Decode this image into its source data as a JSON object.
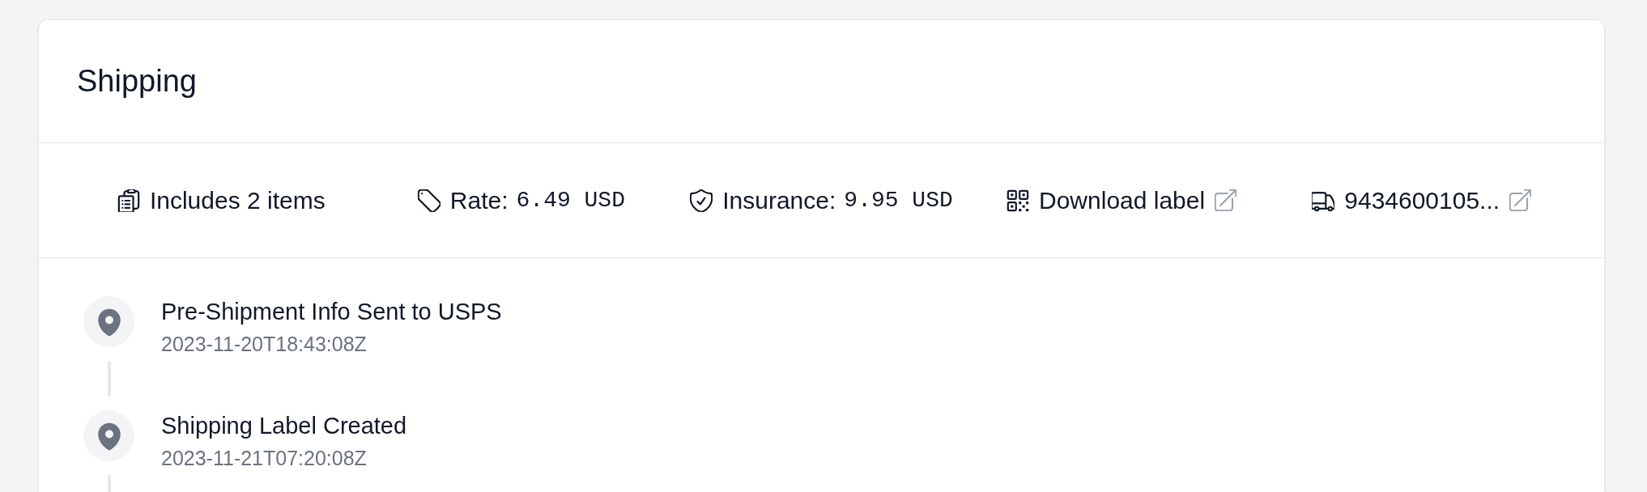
{
  "card": {
    "title": "Shipping"
  },
  "info_items": [
    {
      "kind": "text",
      "label": "Includes 2 items"
    },
    {
      "kind": "amount",
      "label": "Rate:",
      "value": "6.49 USD"
    },
    {
      "kind": "amount",
      "label": "Insurance:",
      "value": "9.95 USD"
    },
    {
      "kind": "link",
      "label": "Download label"
    },
    {
      "kind": "link",
      "label": "9434600105..."
    }
  ],
  "events": [
    {
      "title": "Pre-Shipment Info Sent to USPS",
      "time": "2023-11-20T18:43:08Z"
    },
    {
      "title": "Shipping Label Created",
      "time": "2023-11-21T07:20:08Z"
    }
  ]
}
